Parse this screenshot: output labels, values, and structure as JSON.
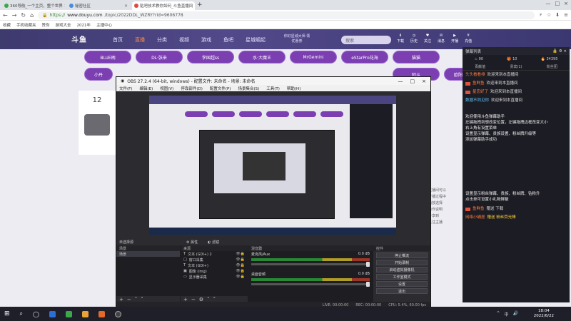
{
  "browser": {
    "tabs": [
      {
        "title": "360导航_一个主页，整个世界",
        "color": "#3aa84a"
      },
      {
        "title": "秘密社区",
        "color": "#4a8ae0"
      },
      {
        "title": "贴吧技术教你如何_斗鱼直播间",
        "color": "#e04a3a"
      }
    ],
    "url_secure": "https://",
    "url_host": "www.douyu.com",
    "url_path": "/topic/2022DDL_WZRY?rid=9606778",
    "bookmarks": [
      "收藏",
      "手机收藏夹",
      "赞你",
      "游戏大全",
      "2021年",
      "主播中心"
    ]
  },
  "douyu": {
    "logo": "斗鱼",
    "nav": [
      "首页",
      "直播",
      "分类",
      "视频",
      "游戏",
      "鱼吧",
      "星城崛起"
    ],
    "active_nav": "直播",
    "promo": "你好星城大师 领优惠券",
    "search_placeholder": "搜索",
    "header_icons": [
      "下载",
      "历史",
      "关注",
      "消息",
      "开播",
      "充值"
    ],
    "pills_row1": [
      "BLUE柄",
      "DL·张来",
      "李国超ss",
      "水·大魔王",
      "MrGemini",
      "eStarPro花海",
      "猫猫"
    ],
    "pills_row2": [
      "小丹",
      "阿斗",
      "欧阳"
    ],
    "left_card_count": "12",
    "right_desc": [
      "直播间可以",
      "开播过程中",
      "播放选择",
      "操作说明",
      "分享到",
      "关注主播"
    ]
  },
  "chat": {
    "header": "弹幕列表",
    "stats": [
      "90",
      "10",
      "34395"
    ],
    "tabs": [
      "贡献值",
      "贵宾(1)",
      "粉丝团"
    ],
    "messages": [
      {
        "name": "头头看看排",
        "text": "欢迎来到本直播间",
        "guest": false
      },
      {
        "name": "鱼鲜鱼",
        "text": "欢迎来到本直播间",
        "guest": false
      },
      {
        "name": "星恋好了",
        "text": "欢迎来到本直播间",
        "guest": false
      },
      {
        "name": "数据不同见你",
        "text": "欢迎来到本直播间",
        "guest": true
      }
    ],
    "system_block1": [
      "欢迎使用斗鱼弹幕助手",
      "左键拖拽到想改变位置，左键拖拽边框改变大小",
      "右上角有设置菜单",
      "设置显示弹幕、贵族设置、粉丝牌升级等",
      "添加弹幕助手成功"
    ],
    "system_block2": [
      "设置显示粉丝弹幕、贵族、粉丝牌、钻粉升",
      "点击单可设置小礼物屏蔽"
    ],
    "gift_msgs": [
      {
        "name": "鱼鲜鱼",
        "text": "赠送 下载"
      },
      {
        "name": "网络小蜗居",
        "text": "赠送 粉丝荧光棒"
      }
    ]
  },
  "obs": {
    "title": "OBS 27.2.4 (64-bit, windows) - 配置文件: 未命名 - 场景: 未命名",
    "menu": [
      "文件(F)",
      "编辑(E)",
      "视图(V)",
      "停靠部件(D)",
      "配置文件(P)",
      "场景集合(S)",
      "工具(T)",
      "帮助(H)"
    ],
    "scene_bar": [
      "未选择源",
      "属性",
      "滤镜"
    ],
    "docks": {
      "scenes": "场景",
      "sources": "来源",
      "mixer": "混音器",
      "controls": "控件"
    },
    "scenes_list": [
      "场景"
    ],
    "sources_list": [
      {
        "name": "文本 (GDI+) 2",
        "icon": "T"
      },
      {
        "name": "窗口采集",
        "icon": "□"
      },
      {
        "name": "文本 (GDI+)",
        "icon": "T"
      },
      {
        "name": "图像 (img)",
        "icon": "▣"
      },
      {
        "name": "显示器采集",
        "icon": "▭"
      }
    ],
    "mixer": [
      {
        "name": "麦克风/Aux",
        "db": "0.0 dB"
      },
      {
        "name": "桌面音频",
        "db": "0.0 dB"
      }
    ],
    "controls": [
      "停止推流",
      "开始录制",
      "启动虚拟摄像机",
      "工作室模式",
      "设置",
      "退出"
    ],
    "status": [
      "LIVE: 00:00:00",
      "REC: 00:00:00",
      "CPU: 5.4%, 60.00 fps"
    ]
  },
  "taskbar": {
    "time": "18:04",
    "date": "2022/6/22",
    "tray": [
      "^",
      "中",
      "🔊"
    ]
  }
}
